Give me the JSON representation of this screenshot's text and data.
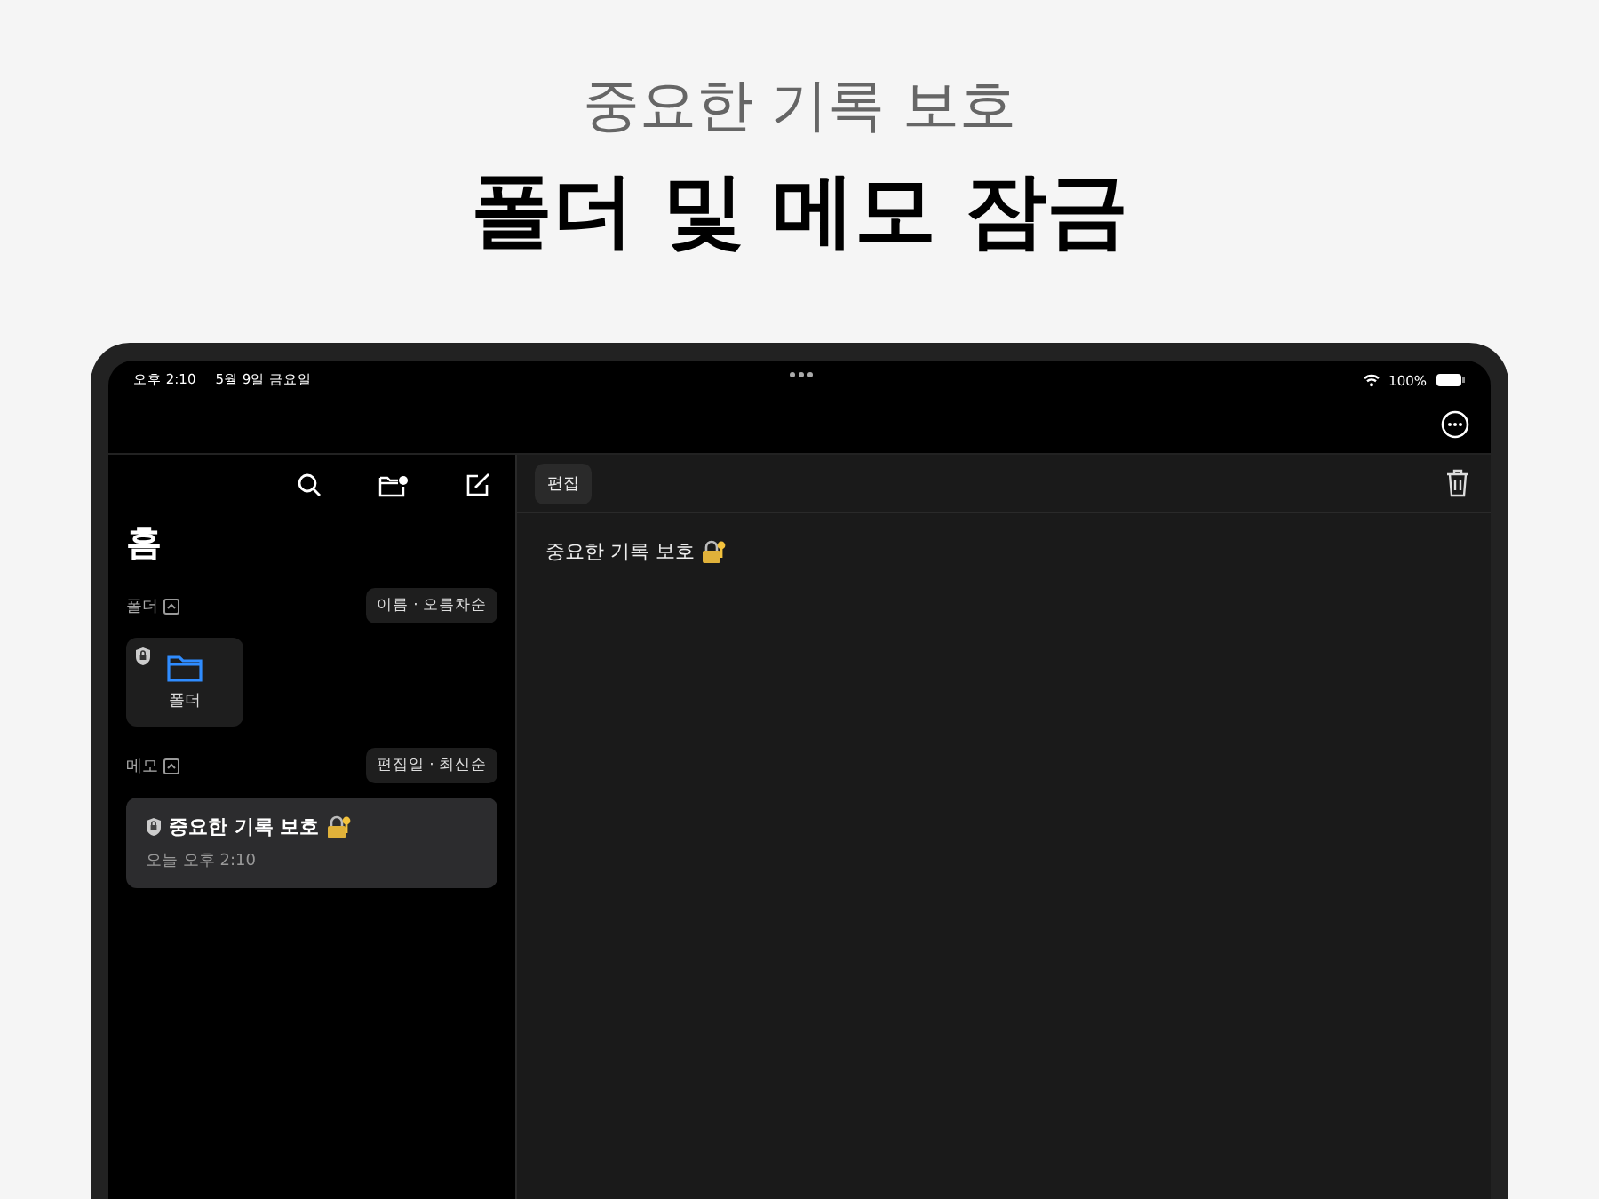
{
  "headline": {
    "subtitle": "중요한 기록 보호",
    "title": "폴더 및 메모 잠금"
  },
  "status_bar": {
    "time": "오후 2:10",
    "date": "5월 9일 금요일",
    "battery": "100%"
  },
  "sidebar": {
    "title": "홈",
    "folders_section": {
      "label": "폴더",
      "expanded": true,
      "sort": "이름 · 오름차순",
      "items": [
        {
          "name": "폴더",
          "locked": true
        }
      ]
    },
    "notes_section": {
      "label": "메모",
      "expanded": true,
      "sort": "편집일 ·  최신순",
      "items": [
        {
          "title": "중요한 기록 보호",
          "time": "오늘 오후 2:10",
          "locked": true,
          "selected": true
        }
      ]
    }
  },
  "editor": {
    "edit_button": "편집",
    "body": "중요한 기록 보호"
  }
}
